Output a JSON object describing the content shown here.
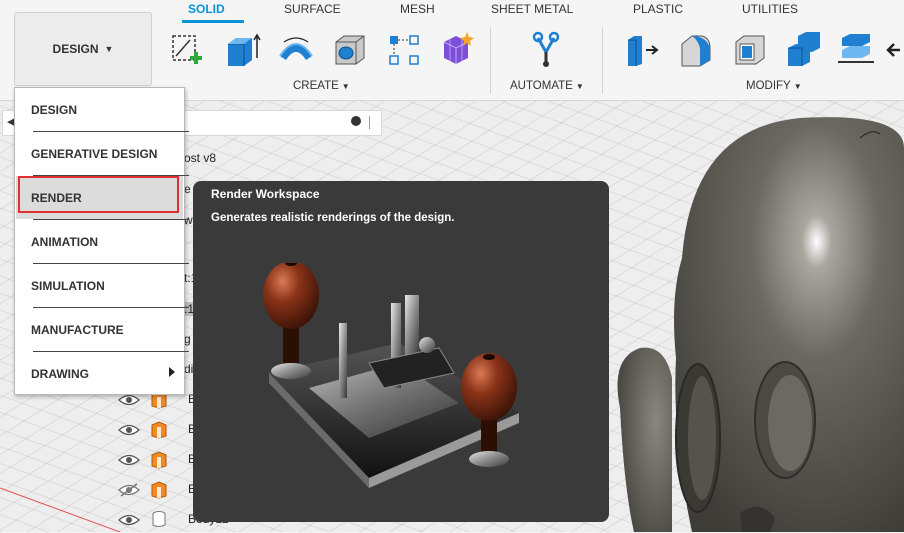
{
  "toolbar": {
    "workspace_button": "DESIGN",
    "tabs": [
      "SOLID",
      "SURFACE",
      "MESH",
      "SHEET METAL",
      "PLASTIC",
      "UTILITIES"
    ],
    "groups": [
      "CREATE",
      "AUTOMATE",
      "MODIFY"
    ],
    "tools": {
      "create": [
        "create-sketch-icon",
        "extrude-icon",
        "revolve-icon",
        "hole-icon",
        "rectangular-pattern-icon",
        "form-icon"
      ],
      "automate": [
        "automate-icon"
      ],
      "modify": [
        "press-pull-icon",
        "fillet-icon",
        "shell-icon",
        "combine-icon",
        "align-icon",
        "move-icon"
      ]
    }
  },
  "workspace_menu": {
    "items": [
      "DESIGN",
      "GENERATIVE DESIGN",
      "RENDER",
      "ANIMATION",
      "SIMULATION",
      "MANUFACTURE",
      "DRAWING"
    ],
    "highlighted": "RENDER"
  },
  "tooltip": {
    "title": "Render Workspace",
    "description": "Generates realistic renderings of the design.",
    "image": "router-plane-render"
  },
  "browser": {
    "visible_fragments": [
      "ost v8",
      "e",
      "ws",
      "t:1",
      ":1",
      "g",
      "di"
    ],
    "rows": [
      {
        "name": "B",
        "visible": true
      },
      {
        "name": "B",
        "visible": true
      },
      {
        "name": "B",
        "visible": true
      },
      {
        "name": "B",
        "visible": false
      },
      {
        "name": "Body12",
        "visible": true
      }
    ]
  },
  "colors": {
    "accent": "#0696d7",
    "highlight_border": "#e03030",
    "tooltip_bg": "#3a3a3a",
    "model_color": "#5e5b54"
  }
}
